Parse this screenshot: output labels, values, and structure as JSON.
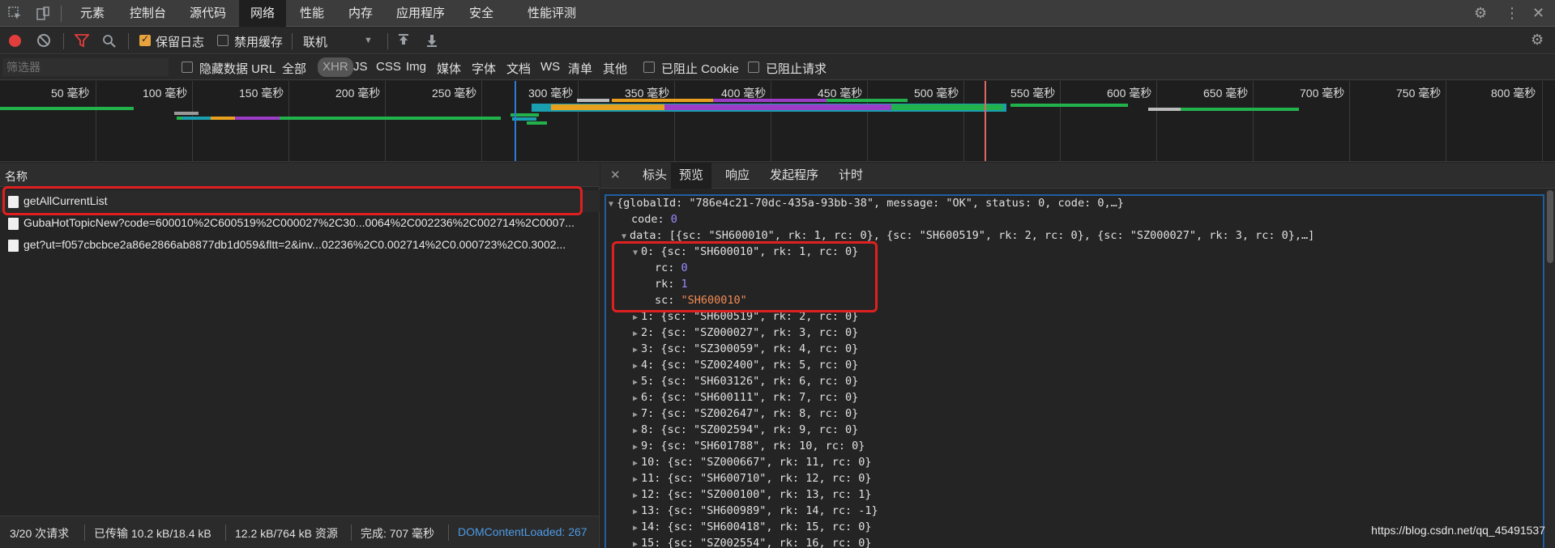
{
  "tabs": [
    "元素",
    "控制台",
    "源代码",
    "网络",
    "性能",
    "内存",
    "应用程序",
    "安全",
    "性能评测"
  ],
  "active_tab": "网络",
  "toolbar": {
    "preserve_log": "保留日志",
    "disable_cache": "禁用缓存",
    "throttling": "联机"
  },
  "filter": {
    "placeholder": "筛选器",
    "hide_data_urls": "隐藏数据 URL",
    "types": [
      "全部",
      "XHR",
      "JS",
      "CSS",
      "Img",
      "媒体",
      "字体",
      "文档",
      "WS",
      "清单",
      "其他"
    ],
    "selected_type": "XHR",
    "blocked_cookies": "已阻止 Cookie",
    "blocked_requests": "已阻止请求"
  },
  "timeline_labels": [
    "50 毫秒",
    "100 毫秒",
    "150 毫秒",
    "200 毫秒",
    "250 毫秒",
    "300 毫秒",
    "350 毫秒",
    "400 毫秒",
    "450 毫秒",
    "500 毫秒",
    "550 毫秒",
    "600 毫秒",
    "650 毫秒",
    "700 毫秒",
    "750 毫秒",
    "800 毫秒"
  ],
  "requests_header": "名称",
  "requests": [
    "getAllCurrentList",
    "GubaHotTopicNew?code=600010%2C600519%2C000027%2C30...0064%2C002236%2C002714%2C0007...",
    "get?ut=f057cbcbce2a86e2866ab8877db1d059&fltt=2&inv...02236%2C0.002714%2C0.000723%2C0.3002..."
  ],
  "status": {
    "requests": "3/20 次请求",
    "transferred": "已传输 10.2 kB/18.4 kB",
    "resources": "12.2 kB/764 kB 资源",
    "finish": "完成: 707 毫秒",
    "dcl": "DOMContentLoaded: 267"
  },
  "detail_tabs": [
    "标头",
    "预览",
    "响应",
    "发起程序",
    "计时"
  ],
  "active_detail_tab": "预览",
  "json_lines": {
    "root": "{globalId: \"786e4c21-70dc-435a-93bb-38\", message: \"OK\", status: 0, code: 0,…}",
    "code_key": "code: ",
    "code_val": "0",
    "data": "data: [{sc: \"SH600010\", rk: 1, rc: 0}, {sc: \"SH600519\", rk: 2, rc: 0}, {sc: \"SZ000027\", rk: 3, rc: 0},…]",
    "item0": "0: {sc: \"SH600010\", rk: 1, rc: 0}",
    "rc_key": "rc: ",
    "rc_val": "0",
    "rk_key": "rk: ",
    "rk_val": "1",
    "sc_key": "sc: ",
    "sc_val": "\"SH600010\"",
    "items": [
      "1: {sc: \"SH600519\", rk: 2, rc: 0}",
      "2: {sc: \"SZ000027\", rk: 3, rc: 0}",
      "3: {sc: \"SZ300059\", rk: 4, rc: 0}",
      "4: {sc: \"SZ002400\", rk: 5, rc: 0}",
      "5: {sc: \"SH603126\", rk: 6, rc: 0}",
      "6: {sc: \"SH600111\", rk: 7, rc: 0}",
      "7: {sc: \"SZ002647\", rk: 8, rc: 0}",
      "8: {sc: \"SZ002594\", rk: 9, rc: 0}",
      "9: {sc: \"SH601788\", rk: 10, rc: 0}",
      "10: {sc: \"SZ000667\", rk: 11, rc: 0}",
      "11: {sc: \"SH600710\", rk: 12, rc: 0}",
      "12: {sc: \"SZ000100\", rk: 13, rc: 1}",
      "13: {sc: \"SH600989\", rk: 14, rc: -1}",
      "14: {sc: \"SH600418\", rk: 15, rc: 0}",
      "15: {sc: \"SZ002554\", rk: 16, rc: 0}"
    ]
  },
  "watermark": "https://blog.csdn.net/qq_45491537",
  "colors": {
    "accent_red": "#e02020",
    "record_red": "#e23d3d",
    "link_blue": "#4d9be6",
    "number_purple": "#9a8cff",
    "string_orange": "#f28b54"
  }
}
